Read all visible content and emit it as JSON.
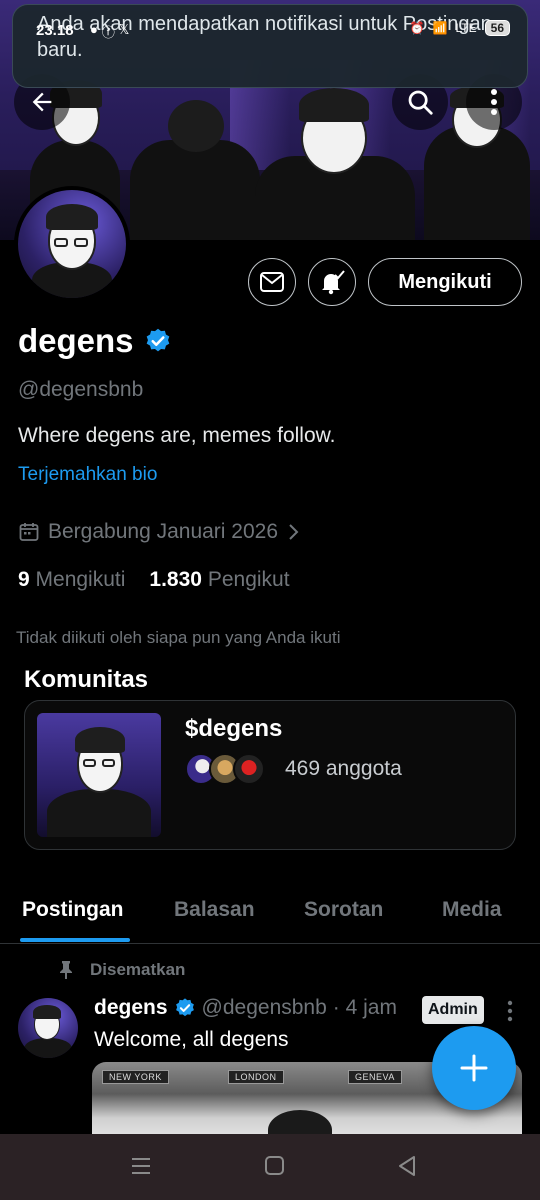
{
  "status_bar": {
    "time": "23.18",
    "battery": "56",
    "network": "LTE"
  },
  "notification": {
    "message": "Anda akan mendapatkan notifikasi untuk Postingan baru."
  },
  "profile": {
    "name": "degens",
    "handle": "@degensbnb",
    "bio": "Where degens are, memes follow.",
    "translate_bio": "Terjemahkan bio",
    "joined": "Bergabung Januari 2026",
    "following_count": "9",
    "following_label": "Mengikuti",
    "followers_count": "1.830",
    "followers_label": "Pengikut",
    "not_followed": "Tidak diikuti oleh siapa pun yang Anda ikuti",
    "follow_button": "Mengikuti",
    "verified_color": "#1d9bf0"
  },
  "community": {
    "section_title": "Komunitas",
    "name": "$degens",
    "members": "469 anggota"
  },
  "tabs": [
    {
      "label": "Postingan",
      "active": true
    },
    {
      "label": "Balasan",
      "active": false
    },
    {
      "label": "Sorotan",
      "active": false
    },
    {
      "label": "Media",
      "active": false
    }
  ],
  "pinned_post": {
    "pinned_label": "Disematkan",
    "author": "degens",
    "handle": "@degensbnb",
    "time": "· 4 jam",
    "badge": "Admin",
    "text": "Welcome, all degens",
    "media_signs": [
      "NEW YORK",
      "LONDON",
      "GENEVA"
    ]
  },
  "icons": {
    "back": "arrow-left-icon",
    "search": "search-icon",
    "more": "more-vertical-icon",
    "message": "mail-icon",
    "notify": "bell-check-icon",
    "calendar": "calendar-icon",
    "pin": "pin-icon",
    "compose": "plus-icon"
  },
  "colors": {
    "accent": "#1d9bf0",
    "background": "#000000",
    "muted": "#71767b"
  }
}
